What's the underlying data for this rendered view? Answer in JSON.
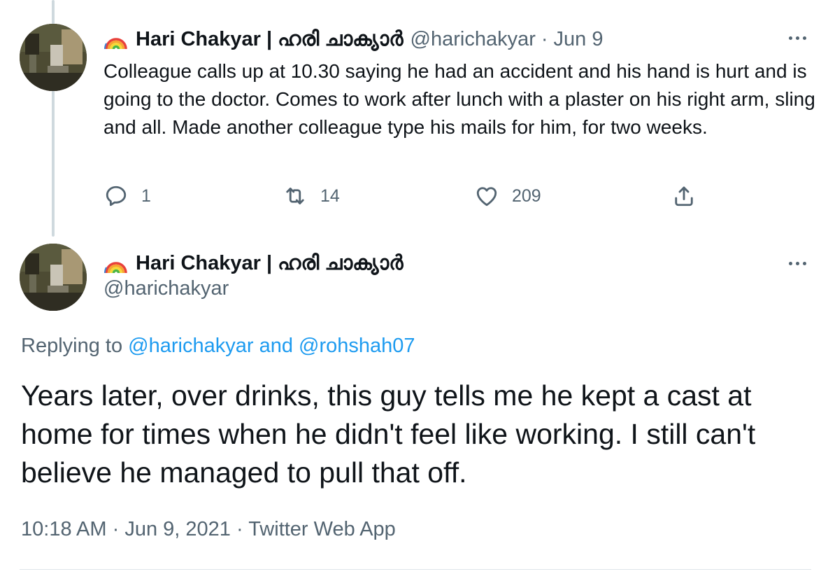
{
  "first_tweet": {
    "display_name": "Hari Chakyar | ഹരി ചാക്യാർ",
    "handle": "@harichakyar",
    "separator": "·",
    "date": "Jun 9",
    "text": "Colleague calls up at 10.30 saying he had an accident and his hand is hurt and is going to the doctor. Comes to work after lunch with a plaster on his right arm, sling and all. Made another colleague type his mails for him, for two weeks.",
    "actions": {
      "reply_icon": "reply-icon",
      "reply_count": "1",
      "retweet_icon": "retweet-icon",
      "retweet_count": "14",
      "like_icon": "heart-icon",
      "like_count": "209",
      "share_icon": "share-icon"
    }
  },
  "main_tweet": {
    "display_name": "Hari Chakyar | ഹരി ചാക്യാർ",
    "handle": "@harichakyar",
    "replying_prefix": "Replying to",
    "reply_mention_1": "@harichakyar",
    "reply_and": "and",
    "reply_mention_2": "@rohshah07",
    "text": "Years later, over drinks, this guy tells me he kept a cast at home for times when he didn't feel like working. I still can't believe he managed to pull that off.",
    "time": "10:18 AM",
    "separator": "·",
    "date": "Jun 9, 2021",
    "source": "Twitter Web App"
  },
  "icons": {
    "rainbow": "rainbow-emoji-icon",
    "more": "more-horizontal-icon"
  },
  "colors": {
    "text_primary": "#0f1419",
    "text_secondary": "#536471",
    "link": "#1d9bf0",
    "thread_line": "#cfd9de"
  }
}
